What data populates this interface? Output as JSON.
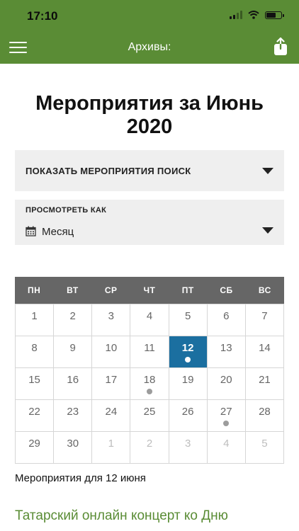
{
  "status": {
    "time": "17:10"
  },
  "nav": {
    "title": "Архивы:"
  },
  "page": {
    "title": "Мероприятия за Июнь 2020"
  },
  "search_toggle": {
    "label": "ПОКАЗАТЬ МЕРОПРИЯТИЯ ПОИСК"
  },
  "view": {
    "label": "ПРОСМОТРЕТЬ КАК",
    "value": "Месяц"
  },
  "calendar": {
    "weekdays": [
      "ПН",
      "ВТ",
      "СР",
      "ЧТ",
      "ПТ",
      "СБ",
      "ВС"
    ],
    "selected_day": "12",
    "days": [
      {
        "d": "1"
      },
      {
        "d": "2"
      },
      {
        "d": "3"
      },
      {
        "d": "4"
      },
      {
        "d": "5"
      },
      {
        "d": "6"
      },
      {
        "d": "7"
      },
      {
        "d": "8"
      },
      {
        "d": "9"
      },
      {
        "d": "10"
      },
      {
        "d": "11"
      },
      {
        "d": "12",
        "event": true
      },
      {
        "d": "13"
      },
      {
        "d": "14"
      },
      {
        "d": "15"
      },
      {
        "d": "16"
      },
      {
        "d": "17"
      },
      {
        "d": "18",
        "event": true
      },
      {
        "d": "19"
      },
      {
        "d": "20"
      },
      {
        "d": "21"
      },
      {
        "d": "22"
      },
      {
        "d": "23"
      },
      {
        "d": "24"
      },
      {
        "d": "25"
      },
      {
        "d": "26"
      },
      {
        "d": "27",
        "event": true
      },
      {
        "d": "28"
      },
      {
        "d": "29"
      },
      {
        "d": "30"
      },
      {
        "d": "1",
        "other": true
      },
      {
        "d": "2",
        "other": true
      },
      {
        "d": "3",
        "other": true
      },
      {
        "d": "4",
        "other": true
      },
      {
        "d": "5",
        "other": true
      }
    ]
  },
  "events_for": "Мероприятия для 12 июня",
  "event": {
    "title": "Татарский онлайн концерт ко Дню"
  },
  "colors": {
    "brand": "#5a8c35",
    "selected": "#1b6fa0",
    "header": "#666666"
  }
}
